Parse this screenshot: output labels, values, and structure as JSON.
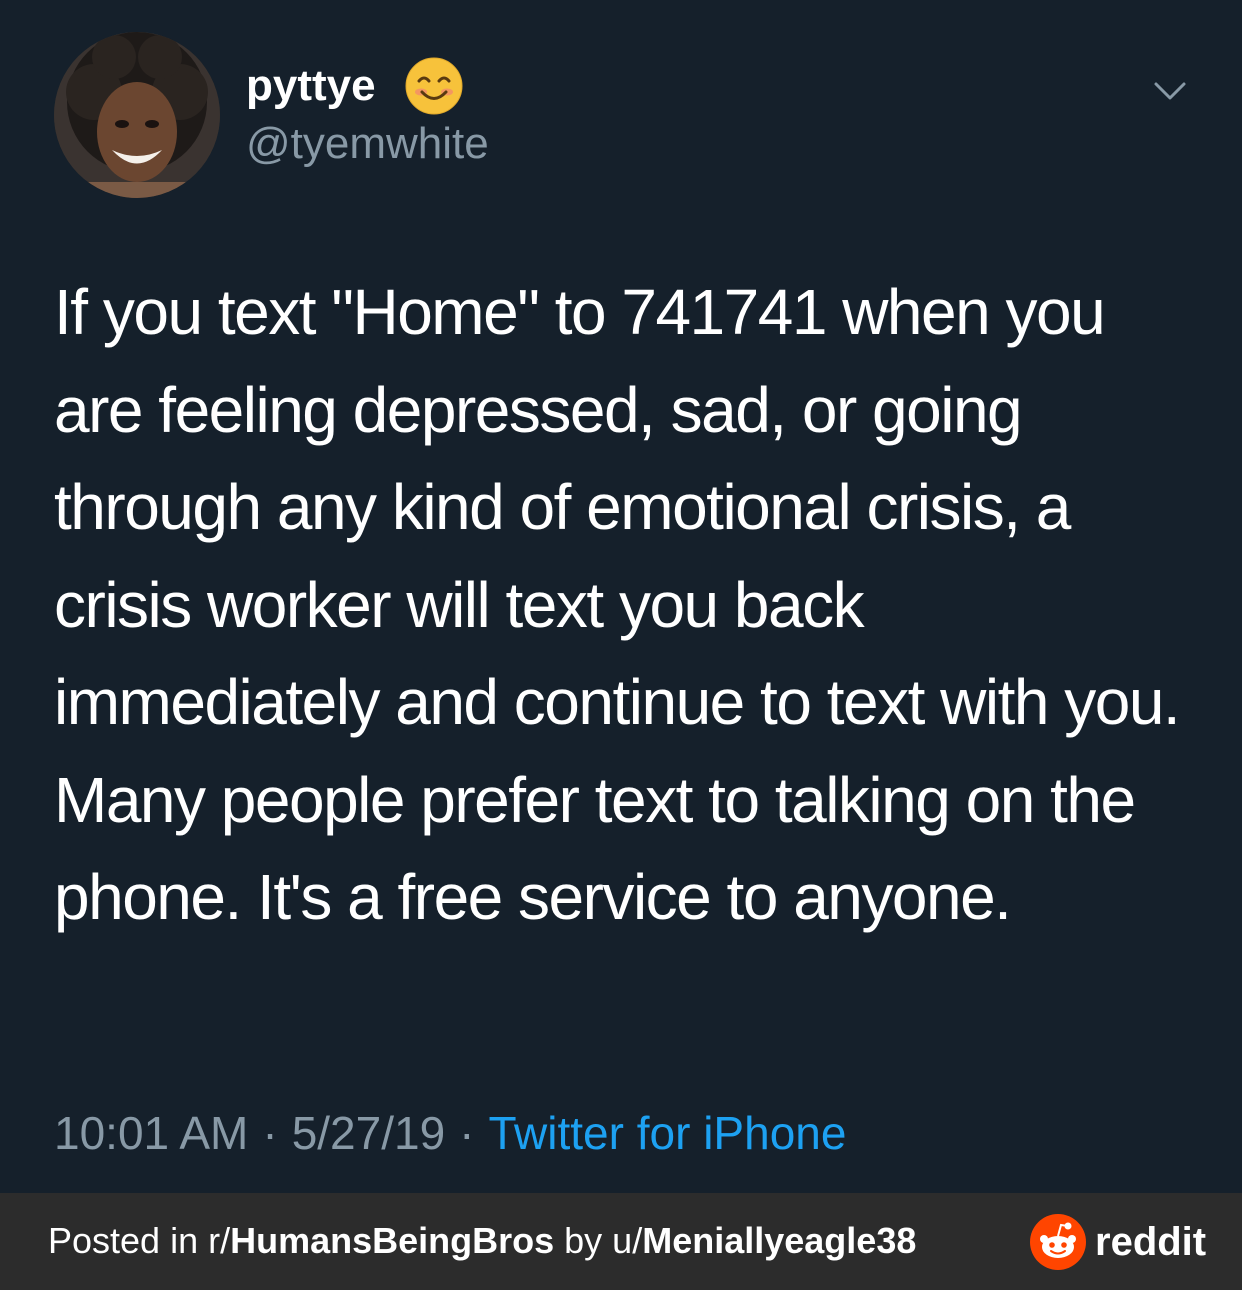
{
  "tweet": {
    "display_name": "pyttye",
    "name_emoji": "smiling-face-emoji",
    "handle": "@tyemwhite",
    "text": "If you text \"Home\" to 741741 when you are feeling depressed, sad, or going through any kind of emotional crisis, a crisis worker will text you back immediately and continue to text with you.  Many people prefer text to talking on the phone. It's a free service to anyone.",
    "time": "10:01 AM",
    "date": "5/27/19",
    "separator": "·",
    "source": "Twitter for iPhone"
  },
  "footer": {
    "prefix": "Posted in r/",
    "subreddit": "HumansBeingBros",
    "by": " by u/",
    "username": "Meniallyeagle38",
    "brand": "reddit"
  },
  "colors": {
    "background": "#15202b",
    "secondary_text": "#8899a6",
    "link": "#1da1f2",
    "footer_bg": "#2c2c2c",
    "reddit_orange": "#ff4500"
  }
}
